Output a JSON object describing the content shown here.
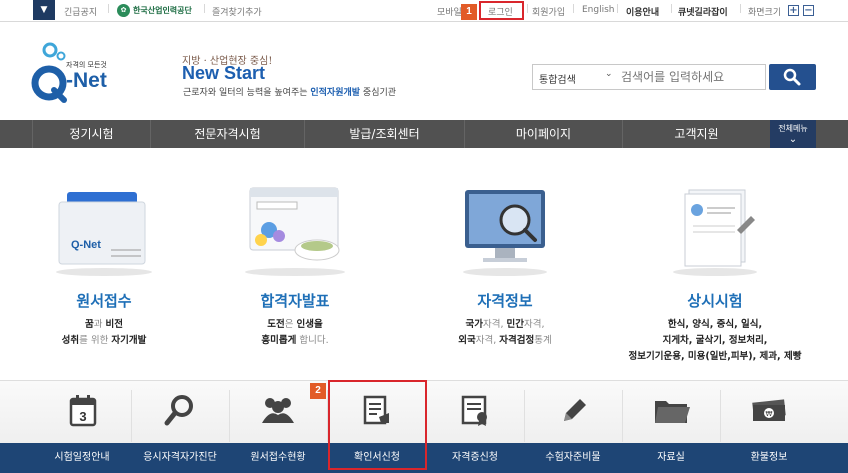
{
  "topbar": {
    "emergency_label": "긴급공지",
    "org_name": "한국산업인력공단",
    "bookmark_label": "즐겨찾기추가",
    "mobile_label": "모바일",
    "login_label": "로그인",
    "join_label": "회원가입",
    "english_label": "English",
    "usage_label": "이용안내",
    "kiosk_label": "큐넷길라잡이",
    "fontsize_label": "화면크기",
    "plus": "+",
    "minus": "−"
  },
  "annotations": {
    "badge1": "1",
    "badge2": "2"
  },
  "header": {
    "logo_tag": "자격의 모든것",
    "logo_q": "Q",
    "logo_net": "-Net",
    "slogan_small": "지방 · 산업현장 중심!",
    "slogan_big": "New Start",
    "slogan_sub_pre": "근로자와 일터의 능력을 높여주는 ",
    "slogan_sub_em": "인적자원개발",
    "slogan_sub_post": " 중심기관"
  },
  "search": {
    "scope": "통합검색",
    "placeholder": "검색어를 입력하세요"
  },
  "nav": {
    "items": [
      "정기시험",
      "전문자격시험",
      "발급/조회센터",
      "마이페이지",
      "고객지원"
    ],
    "all_menu": "전체메뉴"
  },
  "features": [
    {
      "title": "원서접수",
      "lines": [
        [
          "꿈",
          "과 ",
          "비전"
        ],
        [
          "성취",
          "를 위한 ",
          "자기개발"
        ]
      ]
    },
    {
      "title": "합격자발표",
      "lines": [
        [
          "도전",
          "은 ",
          "인생을"
        ],
        [
          "흥미롭게",
          " 합니다.",
          ""
        ]
      ]
    },
    {
      "title": "자격정보",
      "lines": [
        [
          "국가",
          "자격, ",
          "민간",
          "자격,"
        ],
        [
          "외국",
          "자격, ",
          "자격검정",
          "통계"
        ]
      ]
    },
    {
      "title": "상시시험",
      "lines": [
        [
          "한식, 양식, 중식, 일식,"
        ],
        [
          "지게차, 굴삭기, 정보처리,"
        ],
        [
          "정보기기운용, 미용(일반,피부), 제과, 제빵"
        ]
      ]
    }
  ],
  "quick_menu": {
    "items": [
      {
        "label": "시험일정안내",
        "icon": "calendar-icon"
      },
      {
        "label": "응시자격자가진단",
        "icon": "magnifier-icon"
      },
      {
        "label": "원서접수현황",
        "icon": "people-icon"
      },
      {
        "label": "확인서신청",
        "icon": "document-hand-icon"
      },
      {
        "label": "자격증신청",
        "icon": "certificate-icon"
      },
      {
        "label": "수험자준비물",
        "icon": "pencil-icon"
      },
      {
        "label": "자료실",
        "icon": "folder-icon"
      },
      {
        "label": "환불정보",
        "icon": "money-icon"
      }
    ],
    "calendar_day": "3"
  },
  "colors": {
    "brand_blue": "#1e6fb7",
    "nav_gray": "#515151",
    "quick_bar": "#1e4575",
    "highlight_red": "#d9262c",
    "badge_orange": "#e25b27"
  }
}
